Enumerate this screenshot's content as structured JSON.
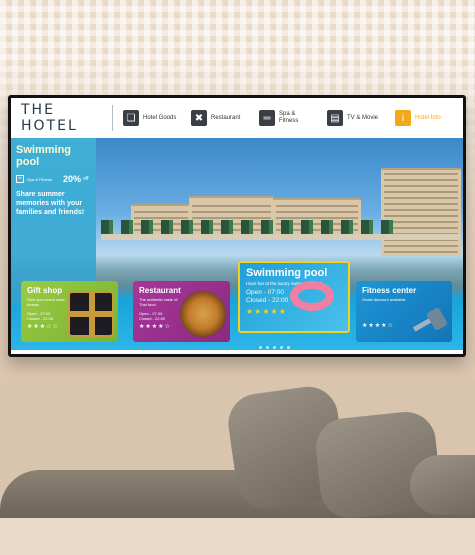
{
  "brand": {
    "logo": "THE HOTEL"
  },
  "nav": [
    {
      "label": "Hotel Goods",
      "icon": "gift-icon"
    },
    {
      "label": "Restaurant",
      "icon": "restaurant-icon"
    },
    {
      "label": "Spa & Fitness",
      "icon": "fitness-icon"
    },
    {
      "label": "TV & Movie",
      "icon": "clapperboard-icon"
    },
    {
      "label": "Hotel Info",
      "icon": "info-icon",
      "active": true
    }
  ],
  "promo": {
    "title": "Swimming pool",
    "tag": "Spa & Fitness",
    "discount": "20%",
    "discount_suffix": "off",
    "body": "Share summer memories with your families and friends!"
  },
  "cards": {
    "gift": {
      "title": "Gift shop",
      "desc": "Give your loved ones beauty",
      "open": "Open - 07:00",
      "closed": "Closed - 22:00",
      "stars": "★★★☆☆"
    },
    "restaurant": {
      "title": "Restaurant",
      "desc": "The authentic taste of Thai food",
      "open": "Open - 07:00",
      "closed": "Closed - 22:00",
      "stars": "★★★★☆"
    },
    "pool": {
      "title": "Swimming pool",
      "desc": "Have fun at the luxury swimming pool",
      "open": "Open - 07:00",
      "closed": "Closed - 22:00",
      "stars": "★★★★★"
    },
    "fitness": {
      "title": "Fitness center",
      "desc": "Guest discount available",
      "stars": "★★★★☆"
    }
  },
  "colors": {
    "accent": "#f2a81d",
    "gift_bg": "#8cc23f",
    "restaurant_bg": "#9b2f8e",
    "pool_bg": "#2aa8dd",
    "fitness_bg": "#1a8fd0"
  }
}
